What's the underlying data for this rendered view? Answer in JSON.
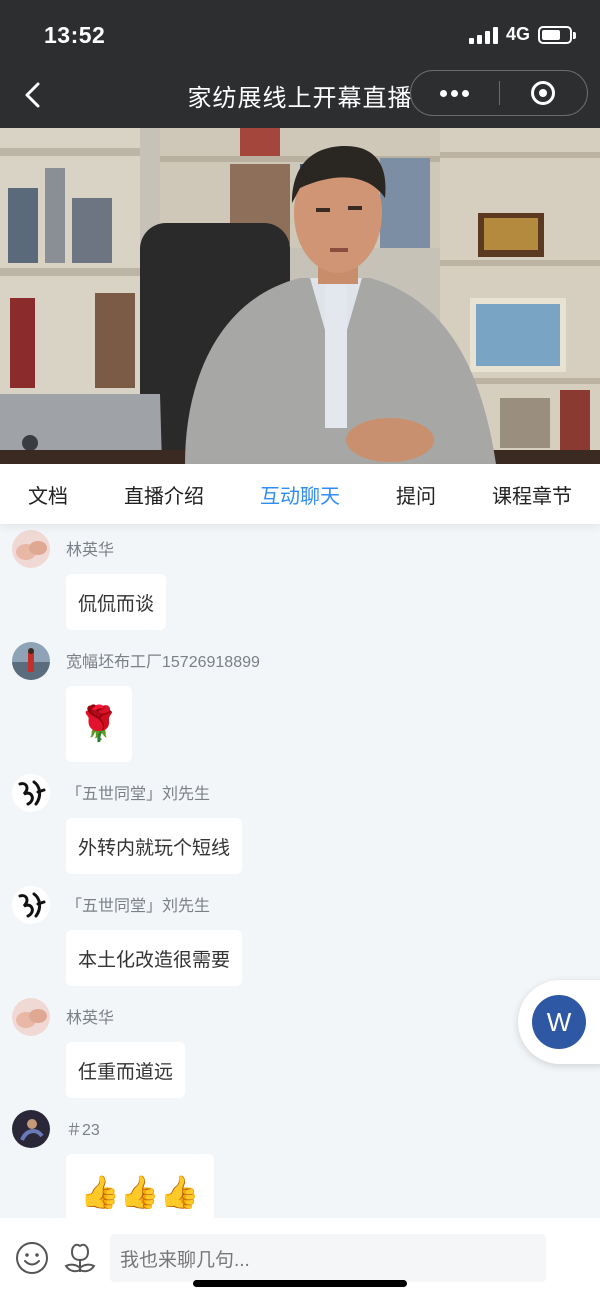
{
  "status": {
    "time": "13:52",
    "network": "4G"
  },
  "header": {
    "title": "家纺展线上开幕直播"
  },
  "tabs": [
    "文档",
    "直播介绍",
    "互动聊天",
    "提问",
    "课程章节"
  ],
  "active_tab": "互动聊天",
  "chat": [
    {
      "name": "林英华",
      "text": "侃侃而谈",
      "avatar": "pink-hands-avatar"
    },
    {
      "name": "宽幅坯布工厂15726918899",
      "text": "",
      "emoji": "🌹",
      "avatar": "landscape-avatar"
    },
    {
      "name": "「五世同堂」刘先生",
      "text": "外转内就玩个短线",
      "avatar": "calligraphy-avatar"
    },
    {
      "name": "「五世同堂」刘先生",
      "text": "本土化改造很需要",
      "avatar": "calligraphy-avatar"
    },
    {
      "name": "林英华",
      "text": "任重而道远",
      "avatar": "pink-hands-avatar"
    },
    {
      "name": "＃23",
      "text": "",
      "emoji": "👍👍👍",
      "avatar": "dark-figure-avatar"
    }
  ],
  "floating_button": {
    "label": "W"
  },
  "input": {
    "placeholder": "我也来聊几句..."
  },
  "colors": {
    "accent": "#2f8df3",
    "topbar": "#2d2e30",
    "chat_bg": "#f3f6f8",
    "float_circle": "#2e57a4"
  }
}
